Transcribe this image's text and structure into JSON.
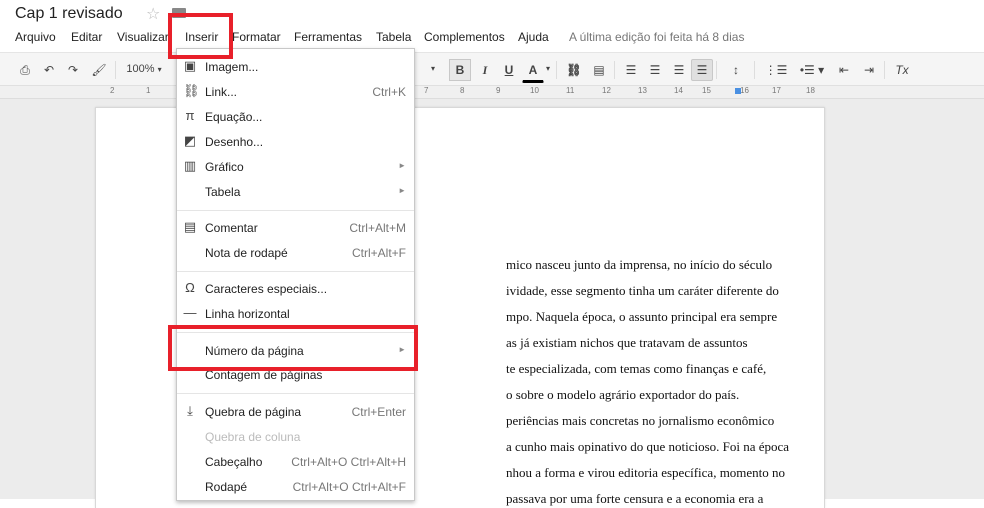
{
  "title": {
    "doc_name": "Cap 1 revisado"
  },
  "menu": {
    "items": [
      {
        "label": "Arquivo"
      },
      {
        "label": "Editar"
      },
      {
        "label": "Visualizar"
      },
      {
        "label": "Inserir"
      },
      {
        "label": "Formatar"
      },
      {
        "label": "Ferramentas"
      },
      {
        "label": "Tabela"
      },
      {
        "label": "Complementos"
      },
      {
        "label": "Ajuda"
      }
    ],
    "last_edit": "A última edição foi feita há 8 dias"
  },
  "toolbar": {
    "zoom": "100%",
    "bold": "B",
    "italic": "I",
    "underline": "U",
    "text_color": "A",
    "clear_format": "Tx"
  },
  "ruler": {
    "numbers": [
      "2",
      "1",
      "7",
      "8",
      "9",
      "10",
      "11",
      "12",
      "13",
      "14",
      "15",
      "16",
      "17",
      "18"
    ]
  },
  "insert_menu": {
    "items": [
      {
        "label": "Imagem...",
        "icon": "image-icon"
      },
      {
        "label": "Link...",
        "icon": "link-icon",
        "shortcut": "Ctrl+K"
      },
      {
        "label": "Equação...",
        "icon": "pi-icon"
      },
      {
        "label": "Desenho...",
        "icon": "drawing-icon"
      },
      {
        "label": "Gráfico",
        "icon": "chart-icon",
        "submenu": true
      },
      {
        "label": "Tabela",
        "submenu": true
      },
      {
        "label": "Comentar",
        "icon": "comment-icon",
        "shortcut": "Ctrl+Alt+M"
      },
      {
        "label": "Nota de rodapé",
        "shortcut": "Ctrl+Alt+F"
      },
      {
        "label": "Caracteres especiais...",
        "icon": "omega-icon"
      },
      {
        "label": "Linha horizontal",
        "icon": "horizontal-line-icon"
      },
      {
        "label": "Número da página",
        "submenu": true
      },
      {
        "label": "Contagem de páginas"
      },
      {
        "label": "Quebra de página",
        "icon": "page-break-icon",
        "shortcut": "Ctrl+Enter"
      },
      {
        "label": "Quebra de coluna",
        "disabled": true
      },
      {
        "label": "Cabeçalho",
        "shortcut": "Ctrl+Alt+O Ctrl+Alt+H"
      },
      {
        "label": "Rodapé",
        "shortcut": "Ctrl+Alt+O Ctrl+Alt+F"
      }
    ]
  },
  "document": {
    "lines": [
      "mico nasceu junto da imprensa, no início do século",
      "ividade, esse segmento tinha um caráter diferente do",
      "mpo. Naquela época, o assunto principal era sempre",
      "as já existiam nichos que tratavam de assuntos",
      "te especializada, com temas como finanças e café,",
      "o sobre o modelo agrário exportador do país.",
      "periências mais concretas no jornalismo econômico",
      "a cunho mais opinativo do que noticioso. Foi na época",
      "nhou a forma e virou editoria específica, momento no",
      "passava por uma forte censura e a economia era a"
    ]
  },
  "colors": {
    "highlight": "#e8202a",
    "accent": "#4a90e2"
  }
}
